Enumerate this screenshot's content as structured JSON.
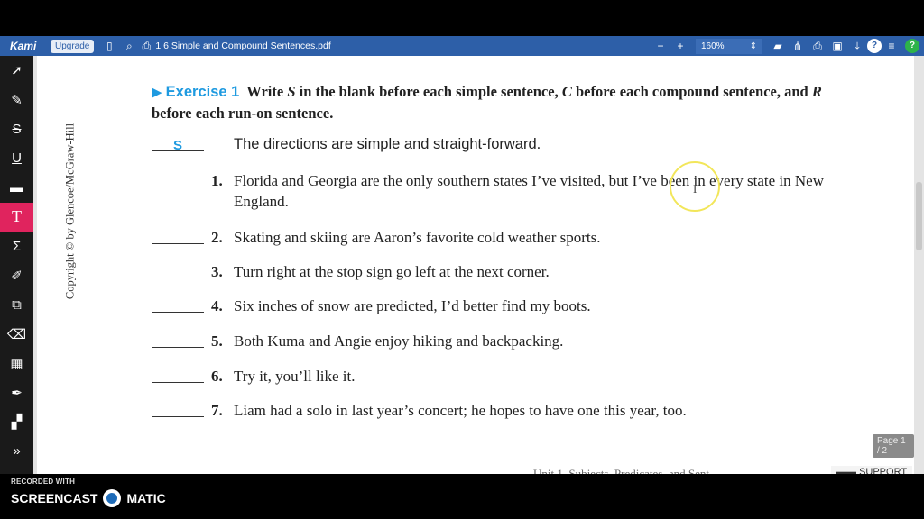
{
  "toolbar": {
    "brand": "Kami",
    "upgrade_label": "Upgrade",
    "filename": "1 6 Simple and Compound Sentences.pdf",
    "zoom_value": "160%",
    "minus_icon": "minus-icon",
    "plus_icon": "plus-icon",
    "accent": "#2d5fa8"
  },
  "left_tools": [
    "select-icon",
    "highlighter-icon",
    "strikethrough-icon",
    "underline-icon",
    "comment-icon",
    "text-icon",
    "equation-icon",
    "drawing-icon",
    "shapes-icon",
    "eraser-icon",
    "image-icon",
    "signature-icon",
    "page-icon",
    "expand-icon"
  ],
  "document": {
    "side_text": "Copyright © by Glencoe/McGraw-Hill",
    "exercise_title": "Exercise 1",
    "instruction_1": "Write ",
    "instruction_s": "S",
    "instruction_2": " in the blank before each simple sentence, ",
    "instruction_c": "C",
    "instruction_3": " before each compound sentence, and ",
    "instruction_r": "R",
    "instruction_4": " before each run-on sentence.",
    "sample": {
      "answer": "S",
      "text": "The directions are simple and straight-forward."
    },
    "items": [
      {
        "num": "1.",
        "text": "Florida and Georgia are the only southern states I’ve visited, but I’ve been in every state in New England."
      },
      {
        "num": "2.",
        "text": "Skating and skiing are Aaron’s favorite cold weather sports."
      },
      {
        "num": "3.",
        "text": "Turn right at the stop sign go left at the next corner."
      },
      {
        "num": "4.",
        "text": "Six inches of snow are predicted, I’d better find my boots."
      },
      {
        "num": "5.",
        "text": "Both Kuma and Angie enjoy hiking and backpacking."
      },
      {
        "num": "6.",
        "text": "Try it, you’ll like it."
      },
      {
        "num": "7.",
        "text": "Liam had a solo in last year’s concert; he hopes to have one this year, too."
      }
    ],
    "page_indicator": "Page 1 / 2",
    "footer_partial": "Unit 1, Subjects, Predicates, and Sent",
    "support_label": "SUPPORT"
  },
  "recorder": {
    "small": "RECORDED WITH",
    "brand_left": "SCREENCAST",
    "brand_right": "MATIC"
  }
}
